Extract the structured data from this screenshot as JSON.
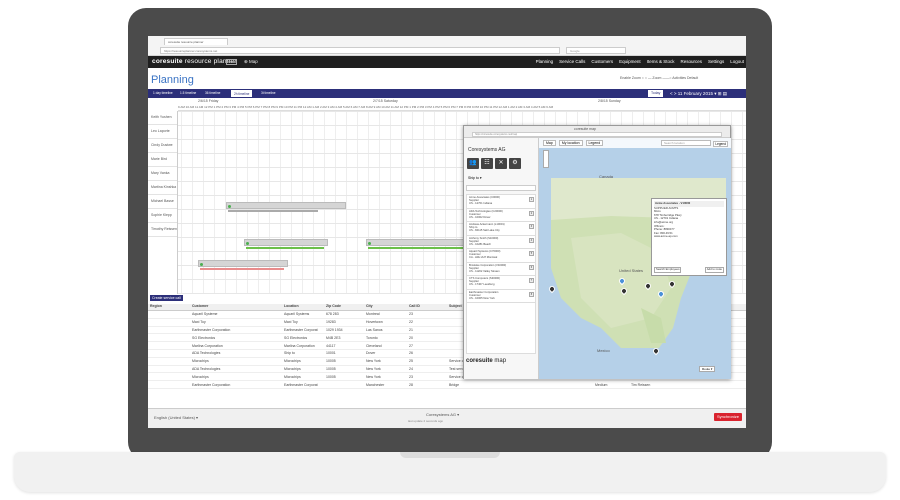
{
  "browser": {
    "tab_title": "coresuite resource planner",
    "url": "https://resourceplanner.coresystems.net",
    "search_placeholder": "Google"
  },
  "app": {
    "brand_core": "coresuite",
    "brand_rest": " resource planner",
    "beta": "beta",
    "map_link": "⊕ Map",
    "nav": [
      "Planning",
      "Service Calls",
      "Customers",
      "Equipment",
      "Items & Stock",
      "Resources",
      "Settings",
      "Logout"
    ]
  },
  "page": {
    "title": "Planning",
    "right_tools": "Enable Zoom ○   ○ — Zoom ——○   Activities   Default"
  },
  "toolbar": {
    "views": [
      "1 day timeline",
      "1.5 timeline",
      "36 timeline",
      "2h timeline",
      "3t timeline"
    ],
    "active_index": 3,
    "today": "Today",
    "date_range": "< > 11 February 2015 ▾  ⊞  ▤"
  },
  "timeline": {
    "days": [
      "2/6/15 Friday",
      "2/7/15 Saturday",
      "2/8/15 Sunday"
    ],
    "hours": "9 AM 10 AM 11 AM 12 PM 1 PM 2 PM 3 PM 4 PM 5 PM 6 PM 7 PM 8 PM 9 PM 10 PM 11 PM 12 AM 1 AM 2 AM 3 AM 4 AM 5 AM 6 AM 7 AM 8 AM 9 AM 10 AM 11 AM 12 PM 1 PM 2 PM 3 PM 4 PM 5 PM 6 PM 7 PM 8 PM 9 PM 10 PM 11 PM 12 AM 1 AM 2 AM 3 AM 4 AM 5 AM 6 AM",
    "resources": [
      "Keith Yushen",
      "Leo Laporte",
      "Cindy Dustwe",
      "Marie Bird",
      "Mary Vanka",
      "Martina Kinshka",
      "Michael Basse",
      "Sophie Klepp",
      "Timothy Reissen"
    ]
  },
  "create_link": "Create service call",
  "table": {
    "headers": [
      "Region",
      "Customer",
      "Location",
      "Zip Code",
      "City",
      "Call ID",
      "Subject",
      "Type",
      "Created",
      "Status",
      "Priority",
      "Assignee"
    ],
    "rows": [
      [
        "",
        "Aquaril Systeme",
        "Aquaril Systems",
        "678 283",
        "Montreal",
        "23",
        "",
        "",
        "",
        "",
        "",
        ""
      ],
      [
        "",
        "Maxi Toy",
        "Maxi Toy",
        "19283",
        "Hovertown",
        "22",
        "",
        "",
        "",
        "",
        "",
        ""
      ],
      [
        "",
        "Earthmaster Corporation",
        "Earthmaster Corporat",
        "1029 1934",
        "Las Sanos",
        "21",
        "",
        "",
        "",
        "",
        "",
        ""
      ],
      [
        "",
        "SG Electronics",
        "SG Electronics",
        "M4B 2E3",
        "Toronto",
        "20",
        "",
        "",
        "",
        "",
        "",
        ""
      ],
      [
        "",
        "Marlina Corporation",
        "Marlina Corporation",
        "44117",
        "Cleveland",
        "27",
        "",
        "",
        "",
        "",
        "",
        ""
      ],
      [
        "",
        "ADA Technologies",
        "Ship to",
        "10001",
        "Dover",
        "26",
        "",
        "",
        "",
        "",
        "",
        ""
      ],
      [
        "",
        "Microchips",
        "Microchips",
        "10005",
        "New York",
        "25",
        "Service call",
        "",
        "",
        "",
        "Medium",
        "Sophie Klepp"
      ],
      [
        "",
        "ADA Technologies",
        "Microchips",
        "10005",
        "New York",
        "24",
        "Test service call",
        "",
        "",
        "",
        "High",
        "Michael Basse"
      ],
      [
        "",
        "Microchips",
        "Microchips",
        "10005",
        "New York",
        "23",
        "Service call",
        "",
        "",
        "",
        "Medium",
        "Sophie Klepp"
      ],
      [
        "",
        "Earthmaster Corporation",
        "Earthmaster Corporat",
        "",
        "Manchester",
        "28",
        "Bridge",
        "",
        "",
        "",
        "Medium",
        "Tim Reissen"
      ]
    ]
  },
  "status": {
    "language": "English (United States) ▾",
    "company": "Coresystems AG ▾",
    "last": "last update 2 seconds ago",
    "sync": "Synchronize"
  },
  "popup": {
    "title": "coresuite map",
    "url": "https://coresuite.coresystems.net/map",
    "panel_title": "Coresystems AG",
    "ship_to": "Ship to ▾",
    "items": [
      [
        "Acme Associates (C0000)",
        "Supplier",
        "US - 12701 Indiana",
        "1"
      ],
      [
        "ADA Technologies (C20000)",
        "Customer",
        "US - 10002 Dover",
        "2"
      ],
      [
        "Andreas Ackermann (L10001)",
        "Ship to",
        "US - 84115 Salt Lake City",
        "3"
      ],
      [
        "Anthony Smith (S10000)",
        "Supplier",
        "US - 10281 Beach",
        "4"
      ],
      [
        "Aquaril Systems (C70000)",
        "Customer",
        "CA - H3H 2H7 Montreal",
        "5"
      ],
      [
        "Brooklee Corporation (V40000)",
        "Supplier",
        "US - 11202 Valley Stream",
        "6"
      ],
      [
        "CTS Computers (S30000)",
        "Supplier",
        "US - 17407 Leesburg",
        "7"
      ],
      [
        "Earthmaster Corporation",
        "Customer",
        "US - 10005 New York",
        "8"
      ]
    ],
    "footer_core": "coresuite",
    "footer_map": " map",
    "map_type": "Map",
    "my_location": "My location",
    "legend": "Legend",
    "search_placeholder": "Search location",
    "legend2": "Legend",
    "country": "United States",
    "canada": "Canada",
    "mexico": "Mexico",
    "info": {
      "head": "Acme Associates - V10000",
      "lines": [
        "SUPPLIER ACMTS",
        "Micro",
        "678 Timberridge Pkwy",
        "US - 12701 Indiana",
        "info@acme.org",
        "Officers:",
        "Phone: 8830477",
        "Fax: 800.49.51",
        "www.acme-ap.com"
      ],
      "button1": "Search Employees",
      "button2": "Add to route"
    },
    "route": "Route ▾"
  }
}
